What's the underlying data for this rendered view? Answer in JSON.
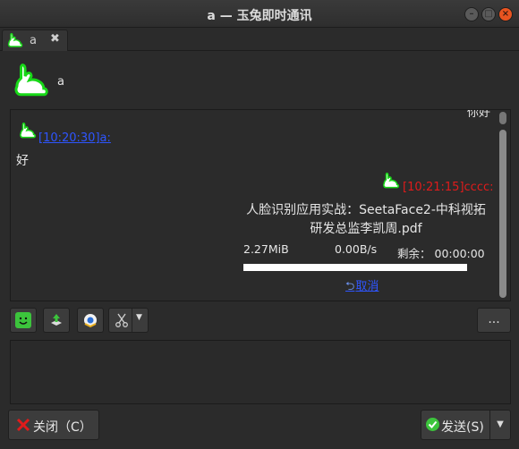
{
  "window": {
    "title": "a — 玉兔即时通讯"
  },
  "tab": {
    "label": "a",
    "close_glyph": "✖"
  },
  "header": {
    "contact_name": "a"
  },
  "chat": {
    "clipped_top_text": "你好",
    "incoming": {
      "header": "[10:20:30]a:",
      "body": "好"
    },
    "outgoing": {
      "header": "[10:21:15]cccc:",
      "file_name": "人脸识别应用实战：SeetaFace2-中科视拓研发总监李凯周.pdf",
      "size": "2.27MiB",
      "speed": "0.00B/s",
      "remaining_label": "剩余：",
      "remaining_time": "00:00:00",
      "progress_fraction": 1.0,
      "cancel_label": "取消"
    }
  },
  "toolbar": {
    "buttons": [
      "emoji-icon",
      "send-file-icon",
      "screenshot-icon",
      "scissors-icon"
    ],
    "more_label": "..."
  },
  "footer": {
    "close_label": "关闭（C）",
    "send_label": "发送(S)"
  },
  "colors": {
    "link": "#2e55ff",
    "self_name": "#e01b1b",
    "rabbit": "#18d818",
    "close_accent": "#e95420"
  }
}
